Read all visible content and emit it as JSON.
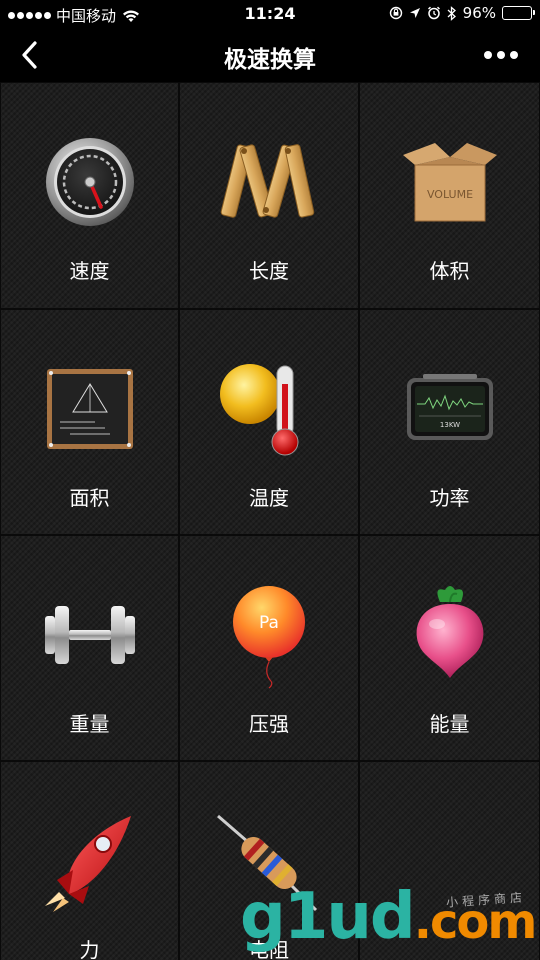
{
  "status_bar": {
    "carrier": "中国移动",
    "time": "11:24",
    "battery": "96%",
    "battery_level": 0.96
  },
  "nav": {
    "title": "极速换算"
  },
  "grid": {
    "items": [
      {
        "label": "速度",
        "icon": "speedometer-icon"
      },
      {
        "label": "长度",
        "icon": "folding-ruler-icon"
      },
      {
        "label": "体积",
        "icon": "volume-box-icon",
        "icon_text": "VOLUME"
      },
      {
        "label": "面积",
        "icon": "blackboard-icon"
      },
      {
        "label": "温度",
        "icon": "thermometer-sun-icon"
      },
      {
        "label": "功率",
        "icon": "power-meter-icon",
        "icon_text": "13KW"
      },
      {
        "label": "重量",
        "icon": "dumbbell-icon"
      },
      {
        "label": "压强",
        "icon": "balloon-icon",
        "icon_text": "Pa"
      },
      {
        "label": "能量",
        "icon": "radish-icon"
      },
      {
        "label": "力",
        "icon": "rocket-icon"
      },
      {
        "label": "电阻",
        "icon": "resistor-icon"
      },
      {
        "label": "",
        "icon": ""
      }
    ]
  },
  "watermark": {
    "brand": "g1ud",
    "suffix": ".com",
    "tagline": "小程序商店"
  },
  "colors": {
    "background": "#000000",
    "cell": "#1f1f1f",
    "battery_fill": "#4cd964",
    "watermark_teal": "#2bb3a3",
    "watermark_green": "#1aa04b",
    "watermark_orange": "#f08a00"
  }
}
